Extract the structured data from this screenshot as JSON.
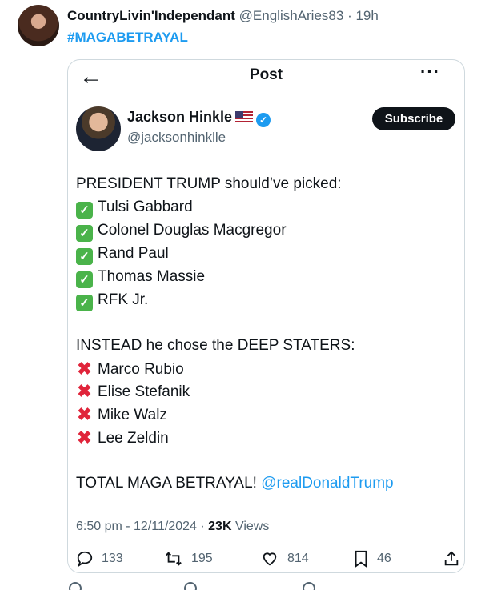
{
  "outer_tweet": {
    "name": "CountryLivin'Independant",
    "handle": "@EnglishAries83",
    "dot": "·",
    "time": "19h",
    "hashtag": "#MAGABETRAYAL"
  },
  "card": {
    "title": "Post",
    "author": {
      "name": "Jackson Hinkle",
      "handle": "@jacksonhinklle",
      "subscribe_label": "Subscribe"
    },
    "intro": "PRESIDENT TRUMP should’ve picked:",
    "picked": [
      "Tulsi Gabbard",
      "Colonel Douglas Macgregor",
      "Rand Paul",
      "Thomas Massie",
      "RFK Jr."
    ],
    "instead": "INSTEAD he chose the DEEP STATERS:",
    "chosen": [
      "Marco Rubio",
      "Elise Stefanik",
      "Mike Walz",
      "Lee Zeldin"
    ],
    "closing_text": "TOTAL MAGA BETRAYAL!",
    "mention": "@realDonaldTrump",
    "meta": {
      "time": "6:50 pm",
      "date": "12/11/2024",
      "views_count": "23K",
      "views_label": "Views"
    },
    "actions": {
      "replies": "133",
      "reposts": "195",
      "likes": "814",
      "bookmarks": "46"
    }
  },
  "colors": {
    "accent": "#1d9bf0",
    "check": "#4ab34a",
    "cross": "#e0243a"
  }
}
